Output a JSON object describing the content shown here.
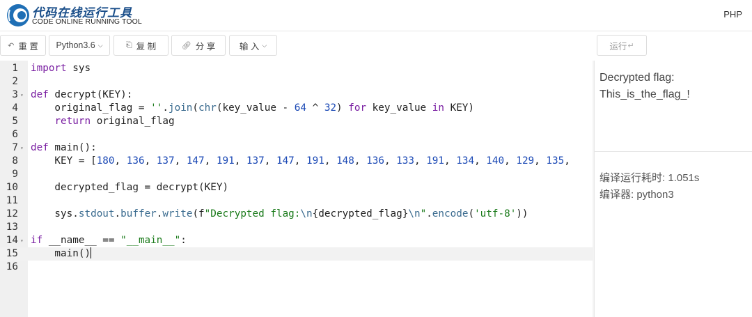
{
  "header": {
    "logo_title": "代码在线运行工具",
    "logo_subtitle": "CODE ONLINE RUNNING TOOL",
    "lang_link": "PHP"
  },
  "toolbar": {
    "reset": {
      "icon": "reset-icon",
      "label": "重 置"
    },
    "version": {
      "label": "Python3.6",
      "icon": "chevron-down-icon"
    },
    "copy": {
      "icon": "copy-icon",
      "label": "复 制"
    },
    "share": {
      "icon": "link-icon",
      "label": "分 享"
    },
    "input": {
      "label": "输 入",
      "icon": "chevron-down-icon"
    },
    "run": {
      "label": "运行",
      "icon": "enter-key-icon"
    }
  },
  "editor": {
    "cursor_line": 15,
    "lines": [
      {
        "n": "1",
        "fold": false,
        "tokens": [
          [
            "kw",
            "import"
          ],
          [
            "t",
            " sys"
          ]
        ]
      },
      {
        "n": "2",
        "fold": false,
        "tokens": []
      },
      {
        "n": "3",
        "fold": true,
        "tokens": [
          [
            "kw",
            "def"
          ],
          [
            "t",
            " decrypt(KEY):"
          ]
        ]
      },
      {
        "n": "4",
        "fold": false,
        "tokens": [
          [
            "t",
            "    original_flag = "
          ],
          [
            "str",
            "''"
          ],
          [
            "t",
            "."
          ],
          [
            "bi",
            "join"
          ],
          [
            "t",
            "("
          ],
          [
            "bi",
            "chr"
          ],
          [
            "t",
            "(key_value - "
          ],
          [
            "num",
            "64"
          ],
          [
            "t",
            " ^ "
          ],
          [
            "num",
            "32"
          ],
          [
            "t",
            ") "
          ],
          [
            "kw",
            "for"
          ],
          [
            "t",
            " key_value "
          ],
          [
            "kw",
            "in"
          ],
          [
            "t",
            " KEY)"
          ]
        ]
      },
      {
        "n": "5",
        "fold": false,
        "tokens": [
          [
            "t",
            "    "
          ],
          [
            "kw",
            "return"
          ],
          [
            "t",
            " original_flag"
          ]
        ]
      },
      {
        "n": "6",
        "fold": false,
        "tokens": []
      },
      {
        "n": "7",
        "fold": true,
        "tokens": [
          [
            "kw",
            "def"
          ],
          [
            "t",
            " main():"
          ]
        ]
      },
      {
        "n": "8",
        "fold": false,
        "tokens": [
          [
            "t",
            "    KEY = ["
          ],
          [
            "num",
            "180"
          ],
          [
            "t",
            ", "
          ],
          [
            "num",
            "136"
          ],
          [
            "t",
            ", "
          ],
          [
            "num",
            "137"
          ],
          [
            "t",
            ", "
          ],
          [
            "num",
            "147"
          ],
          [
            "t",
            ", "
          ],
          [
            "num",
            "191"
          ],
          [
            "t",
            ", "
          ],
          [
            "num",
            "137"
          ],
          [
            "t",
            ", "
          ],
          [
            "num",
            "147"
          ],
          [
            "t",
            ", "
          ],
          [
            "num",
            "191"
          ],
          [
            "t",
            ", "
          ],
          [
            "num",
            "148"
          ],
          [
            "t",
            ", "
          ],
          [
            "num",
            "136"
          ],
          [
            "t",
            ", "
          ],
          [
            "num",
            "133"
          ],
          [
            "t",
            ", "
          ],
          [
            "num",
            "191"
          ],
          [
            "t",
            ", "
          ],
          [
            "num",
            "134"
          ],
          [
            "t",
            ", "
          ],
          [
            "num",
            "140"
          ],
          [
            "t",
            ", "
          ],
          [
            "num",
            "129"
          ],
          [
            "t",
            ", "
          ],
          [
            "num",
            "135"
          ],
          [
            "t",
            ","
          ]
        ]
      },
      {
        "n": "9",
        "fold": false,
        "tokens": []
      },
      {
        "n": "10",
        "fold": false,
        "tokens": [
          [
            "t",
            "    decrypted_flag = decrypt(KEY)"
          ]
        ]
      },
      {
        "n": "11",
        "fold": false,
        "tokens": []
      },
      {
        "n": "12",
        "fold": false,
        "tokens": [
          [
            "t",
            "    sys."
          ],
          [
            "bi",
            "stdout"
          ],
          [
            "t",
            "."
          ],
          [
            "bi",
            "buffer"
          ],
          [
            "t",
            "."
          ],
          [
            "bi",
            "write"
          ],
          [
            "t",
            "(f"
          ],
          [
            "str",
            "\"Decrypted flag:"
          ],
          [
            "bi",
            "\\n"
          ],
          [
            "t",
            "{decrypted_flag}"
          ],
          [
            "bi",
            "\\n"
          ],
          [
            "str",
            "\""
          ],
          [
            "t",
            "."
          ],
          [
            "bi",
            "encode"
          ],
          [
            "t",
            "("
          ],
          [
            "str",
            "'utf-8'"
          ],
          [
            "t",
            "))"
          ]
        ]
      },
      {
        "n": "13",
        "fold": false,
        "tokens": []
      },
      {
        "n": "14",
        "fold": true,
        "tokens": [
          [
            "kw",
            "if"
          ],
          [
            "t",
            " __name__ == "
          ],
          [
            "str",
            "\"__main__\""
          ],
          [
            "t",
            ":"
          ]
        ]
      },
      {
        "n": "15",
        "fold": false,
        "tokens": [
          [
            "t",
            "    main()"
          ]
        ]
      },
      {
        "n": "16",
        "fold": false,
        "tokens": []
      }
    ]
  },
  "output": {
    "line1": "Decrypted flag:",
    "line2": "This_is_the_flag_!",
    "compile_time": "编译运行耗时: 1.051s",
    "compiler": "编译器: python3"
  }
}
